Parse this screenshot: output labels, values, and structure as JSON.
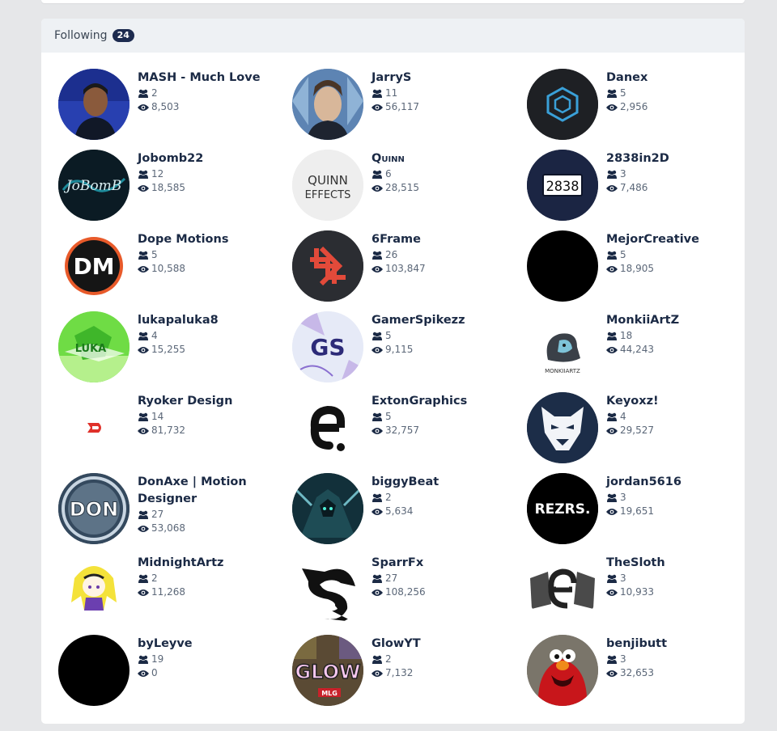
{
  "following": {
    "label": "Following",
    "count": "24"
  },
  "users": [
    {
      "name": "MASH - Much Love",
      "followers": "2",
      "views": "8,503"
    },
    {
      "name": "JarryS",
      "followers": "11",
      "views": "56,117"
    },
    {
      "name": "Danex",
      "followers": "5",
      "views": "2,956"
    },
    {
      "name": "Jobomb22",
      "followers": "12",
      "views": "18,585"
    },
    {
      "name": "Quinn",
      "followers": "6",
      "views": "28,515"
    },
    {
      "name": "2838in2D",
      "followers": "3",
      "views": "7,486"
    },
    {
      "name": "Dope Motions",
      "followers": "5",
      "views": "10,588"
    },
    {
      "name": "6Frame",
      "followers": "26",
      "views": "103,847"
    },
    {
      "name": "MejorCreative",
      "followers": "5",
      "views": "18,905"
    },
    {
      "name": "lukapaluka8",
      "followers": "4",
      "views": "15,255"
    },
    {
      "name": "GamerSpikezz",
      "followers": "5",
      "views": "9,115"
    },
    {
      "name": "MonkiiArtZ",
      "followers": "18",
      "views": "44,243"
    },
    {
      "name": "Ryoker Design",
      "followers": "14",
      "views": "81,732"
    },
    {
      "name": "ExtonGraphics",
      "followers": "5",
      "views": "32,757"
    },
    {
      "name": "Keyoxz!",
      "followers": "4",
      "views": "29,527"
    },
    {
      "name": "DonAxe | Motion Designer",
      "followers": "27",
      "views": "53,068"
    },
    {
      "name": "biggyBeat",
      "followers": "2",
      "views": "5,634"
    },
    {
      "name": "jordan5616",
      "followers": "3",
      "views": "19,651"
    },
    {
      "name": "MidnightArtz",
      "followers": "2",
      "views": "11,268"
    },
    {
      "name": "SparrFx",
      "followers": "27",
      "views": "108,256"
    },
    {
      "name": "TheSloth",
      "followers": "3",
      "views": "10,933"
    },
    {
      "name": "byLeyve",
      "followers": "19",
      "views": "0"
    },
    {
      "name": "GlowYT",
      "followers": "2",
      "views": "7,132"
    },
    {
      "name": "benjibutt",
      "followers": "3",
      "views": "32,653"
    }
  ],
  "avatar_text": {
    "quinn_line1": "QUINN",
    "quinn_line2": "EFFECTS",
    "num_2838": "2838",
    "dm": "DM",
    "gs": "GS",
    "monkii": "MONKIIARTZ",
    "rezrs": "REZRS.",
    "glow": "GLOW",
    "mlg": "MLG",
    "donaxe": "DON",
    "jobomb": "JoBomB"
  },
  "icons": {
    "followers": "users-icon",
    "views": "eye-icon"
  },
  "colors": {
    "header_bg": "#eef1f4",
    "badge_bg": "#1d2b4f",
    "name_text": "#1b2a45"
  }
}
